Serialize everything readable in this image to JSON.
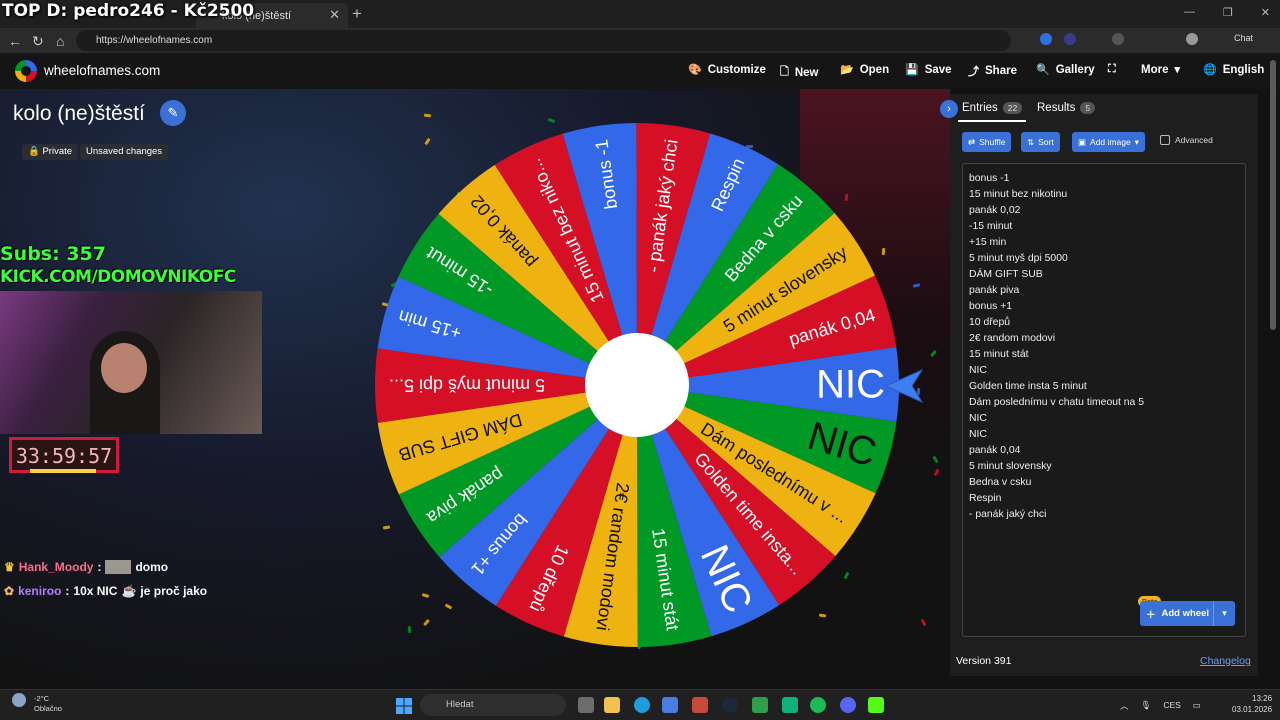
{
  "stream_overlay": {
    "top_donator": "TOP D: pedro246 - Kč2500",
    "subs_label": "Subs: 357",
    "channel": "KICK.COM/DOMOVNIKOFC",
    "timer": "33:59:57"
  },
  "browser": {
    "tab_title": "kolo (ne)štěstí",
    "url": "https://wheelofnames.com",
    "copilot_label": "Chat"
  },
  "app_header": {
    "site_name": "wheelofnames.com",
    "customize": "Customize",
    "new": "New",
    "open": "Open",
    "save": "Save",
    "share": "Share",
    "gallery": "Gallery",
    "more": "More",
    "language": "English"
  },
  "wheel": {
    "title": "kolo (ne)štěstí",
    "privacy": "Private",
    "status": "Unsaved changes",
    "segments": [
      {
        "label": "bonus -1",
        "color": "#3369e8"
      },
      {
        "label": "- panák jaký chci",
        "color": "#d50f25"
      },
      {
        "label": "Respin",
        "color": "#3369e8"
      },
      {
        "label": "Bedna v csku",
        "color": "#009925"
      },
      {
        "label": "5 minut slovensky",
        "color": "#eeb211"
      },
      {
        "label": "panák 0,04",
        "color": "#d50f25"
      },
      {
        "label": "NIC",
        "color": "#3369e8"
      },
      {
        "label": "NIC",
        "color": "#009925"
      },
      {
        "label": "Dám poslednímu v ...",
        "color": "#eeb211"
      },
      {
        "label": "Golden time insta...",
        "color": "#d50f25"
      },
      {
        "label": "NIC",
        "color": "#3369e8"
      },
      {
        "label": "15 minut stát",
        "color": "#009925"
      },
      {
        "label": "2€ random modovi",
        "color": "#eeb211"
      },
      {
        "label": "10 dřepů",
        "color": "#d50f25"
      },
      {
        "label": "bonus +1",
        "color": "#3369e8"
      },
      {
        "label": "panák piva",
        "color": "#009925"
      },
      {
        "label": "DÁM GIFT SUB",
        "color": "#eeb211"
      },
      {
        "label": "5 minut myš dpi 5...",
        "color": "#d50f25"
      },
      {
        "label": "+15 min",
        "color": "#3369e8"
      },
      {
        "label": "-15 minut",
        "color": "#009925"
      },
      {
        "label": "panák 0,02",
        "color": "#eeb211"
      },
      {
        "label": "15 minut bez niko...",
        "color": "#d50f25"
      }
    ]
  },
  "panel": {
    "entries_tab": "Entries",
    "entries_count": "22",
    "results_tab": "Results",
    "results_count": "5",
    "shuffle": "Shuffle",
    "sort": "Sort",
    "add_image": "Add image",
    "advanced": "Advanced",
    "entries": [
      "bonus -1",
      "15 minut bez nikotinu",
      "panák 0,02",
      "-15 minut",
      "+15 min",
      "5 minut myš dpi 5000",
      "DÁM GIFT SUB",
      "panák piva",
      "bonus +1",
      "10 dřepů",
      "2€ random modovi",
      "15 minut stát",
      "NIC",
      "Golden time insta 5 minut",
      "Dám poslednímu v chatu timeout na 5",
      "NIC",
      "NIC",
      "panák 0,04",
      "5 minut slovensky",
      "Bedna v csku",
      "Respin",
      "- panák jaký chci"
    ],
    "beta": "Beta",
    "add_wheel": "Add wheel",
    "version": "Version 391",
    "changelog": "Changelog"
  },
  "chat": [
    {
      "user": "Hank_Moody",
      "user_color": "#ff6b8a",
      "message": "domo"
    },
    {
      "user": "keniroo",
      "user_color": "#b67cff",
      "message": "10x NIC",
      "suffix": "je proč jako"
    }
  ],
  "taskbar": {
    "temperature": "-2°C",
    "weather": "Oblačno",
    "search": "Hledat",
    "language": "CES",
    "time": "13:26",
    "date": "03.01.2026"
  }
}
